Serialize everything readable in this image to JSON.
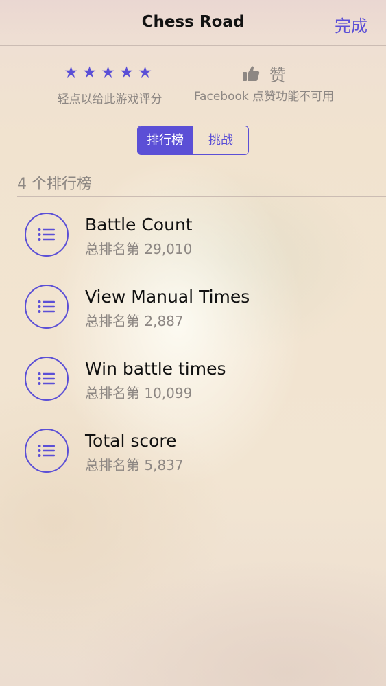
{
  "navbar": {
    "title": "Chess Road",
    "done_label": "完成"
  },
  "rating": {
    "stars": [
      "★",
      "★",
      "★",
      "★",
      "★"
    ],
    "label": "轻点以给此游戏评分"
  },
  "like": {
    "icon": "thumbs-up-icon",
    "text": "赞",
    "label": "Facebook 点赞功能不可用"
  },
  "segments": {
    "leaderboards": "排行榜",
    "challenges": "挑战",
    "selected": "排行榜"
  },
  "section": {
    "header": "4 个排行榜"
  },
  "leaderboards": [
    {
      "icon": "list-icon",
      "title": "Battle Count",
      "rank": "总排名第 29,010"
    },
    {
      "icon": "list-icon",
      "title": "View Manual Times",
      "rank": "总排名第 2,887"
    },
    {
      "icon": "list-icon",
      "title": "Win battle times",
      "rank": "总排名第 10,099"
    },
    {
      "icon": "list-icon",
      "title": "Total score",
      "rank": "总排名第 5,837"
    }
  ],
  "colors": {
    "accent": "#5b4fd6",
    "secondary_text": "#8d8783",
    "primary_text": "#111111"
  }
}
